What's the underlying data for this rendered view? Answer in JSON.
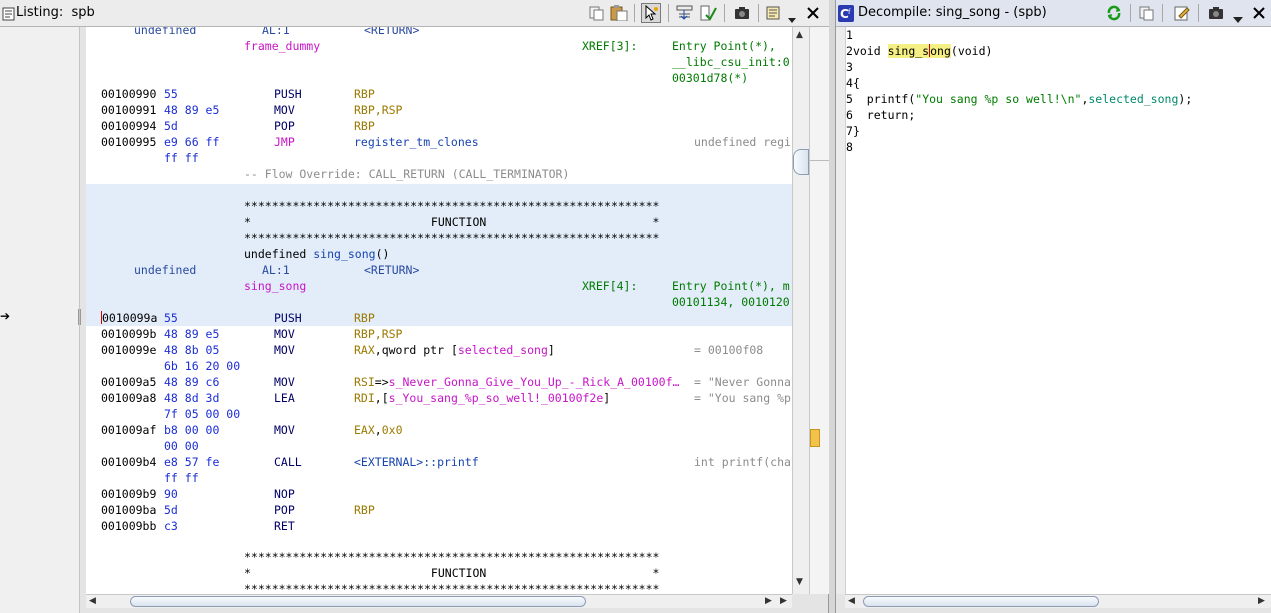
{
  "listing": {
    "title": "Listing:  spb",
    "rows_top": [
      {
        "col_type": "undefined",
        "col_al": "AL:1",
        "col_ret": "<RETURN>"
      },
      {
        "label": "frame_dummy",
        "xref_label": "XREF[3]:",
        "xref_val": "Entry Point(*),"
      },
      {
        "xref_val": "__libc_csu_init:0"
      },
      {
        "xref_val": "00301d78(*)"
      }
    ],
    "instructions_a": [
      {
        "addr": "00100990",
        "bytes": "55",
        "mnem": "PUSH",
        "ops": "RBP"
      },
      {
        "addr": "00100991",
        "bytes": "48 89 e5",
        "mnem": "MOV",
        "ops": "RBP,RSP"
      },
      {
        "addr": "00100994",
        "bytes": "5d",
        "mnem": "POP",
        "ops": "RBP"
      },
      {
        "addr": "00100995",
        "bytes": "e9 66 ff",
        "mnem": "JMP",
        "ops": "register_tm_clones",
        "comment": "undefined regi"
      },
      {
        "addr": "",
        "bytes": "ff ff",
        "mnem": "",
        "ops": ""
      }
    ],
    "flow_override": "-- Flow Override: CALL_RETURN (CALL_TERMINATOR)",
    "banner_stars": "************************************************************",
    "banner_function": "*                          FUNCTION                        *",
    "func_sig_prefix": "undefined ",
    "func_sig_name": "sing_song",
    "func_sig_suffix": "()",
    "func_ret_type": "undefined",
    "func_ret_al": "AL:1",
    "func_ret_ret": "<RETURN>",
    "func_label": "sing_song",
    "func_xref_label": "XREF[4]:",
    "func_xref_val1": "Entry Point(*), m",
    "func_xref_val2": "00101134, 0010120",
    "instructions_b": [
      {
        "addr": "0010099a",
        "bytes": "55",
        "mnem": "PUSH",
        "ops": "RBP",
        "comment": ""
      },
      {
        "addr": "0010099b",
        "bytes": "48 89 e5",
        "mnem": "MOV",
        "ops": "RBP,RSP",
        "comment": ""
      },
      {
        "addr": "0010099e",
        "bytes": "48 8b 05",
        "mnem": "MOV",
        "ops_reg": "RAX",
        "ops_rest": ",qword ptr [",
        "ops_sym": "selected_song",
        "ops_end": "]",
        "comment": "= 00100f08"
      },
      {
        "addr": "",
        "bytes": "6b 16 20 00"
      },
      {
        "addr": "001009a5",
        "bytes": "48 89 c6",
        "mnem": "MOV",
        "ops_reg": "RSI",
        "ops_rest": "=>",
        "ops_sym": "s_Never_Gonna_Give_You_Up_-_Rick_A_00100f…",
        "ops_end": "",
        "comment": "= \"Never Gonna"
      },
      {
        "addr": "001009a8",
        "bytes": "48 8d 3d",
        "mnem": "LEA",
        "ops_reg": "RDI",
        "ops_rest": ",[",
        "ops_sym": "s_You_sang_%p_so_well!_00100f2e",
        "ops_end": "]",
        "comment": "= \"You sang %p"
      },
      {
        "addr": "",
        "bytes": "7f 05 00 00"
      },
      {
        "addr": "001009af",
        "bytes": "b8 00 00",
        "mnem": "MOV",
        "ops_reg": "EAX",
        "ops_rest": ",",
        "ops_sym": "0x0",
        "ops_end": "",
        "comment": ""
      },
      {
        "addr": "",
        "bytes": "00 00"
      },
      {
        "addr": "001009b4",
        "bytes": "e8 57 fe",
        "mnem": "CALL",
        "ops_reg": "",
        "ops_rest": "",
        "ops_sym": "<EXTERNAL>::printf",
        "ops_end": "",
        "comment": "int printf(cha"
      },
      {
        "addr": "",
        "bytes": "ff ff"
      },
      {
        "addr": "001009b9",
        "bytes": "90",
        "mnem": "NOP",
        "ops_reg": "",
        "ops_rest": "",
        "ops_sym": "",
        "ops_end": "",
        "comment": ""
      },
      {
        "addr": "001009ba",
        "bytes": "5d",
        "mnem": "POP",
        "ops_reg": "RBP",
        "ops_rest": "",
        "ops_sym": "",
        "ops_end": "",
        "comment": ""
      },
      {
        "addr": "001009bb",
        "bytes": "c3",
        "mnem": "RET",
        "ops_reg": "",
        "ops_rest": "",
        "ops_sym": "",
        "ops_end": "",
        "comment": ""
      }
    ]
  },
  "decompile": {
    "title": "Decompile: sing_song - (spb)",
    "line_numbers": [
      "1",
      "2",
      "3",
      "4",
      "5",
      "6",
      "7",
      "8"
    ],
    "sig_void": "void ",
    "sig_name_a": "sing_s",
    "sig_name_b": "ong",
    "sig_rest": "(void)",
    "open_brace": "{",
    "printf_call": "printf(",
    "printf_str": "\"You sang %p so well!\\n\"",
    "printf_comma": ",",
    "printf_glob": "selected_song",
    "printf_end": ");",
    "return_stmt": "return;",
    "close_brace": "}"
  },
  "colors": {
    "listing_bg": "#ffffff",
    "highlight_block": "#e2edf9",
    "address_blue": "#1b2dd6",
    "label_magenta": "#c814c8",
    "xref_green": "#007a00",
    "register_olive": "#9a7a00",
    "decompile_title_bg": "#dfe4ee"
  }
}
